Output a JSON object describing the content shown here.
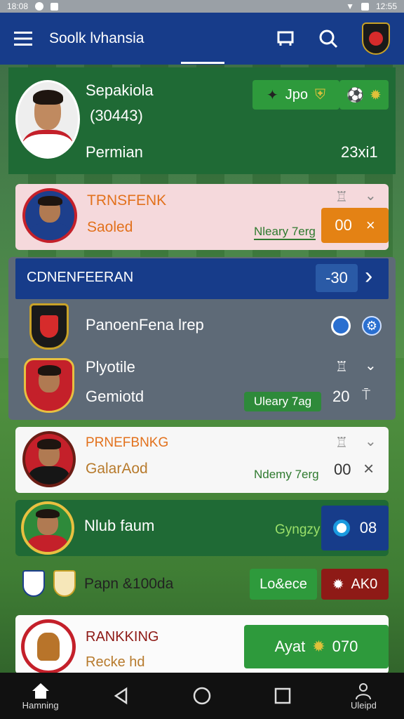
{
  "statusbar": {
    "time_left": "18:08",
    "time_right": "12:55"
  },
  "appbar": {
    "title": "Soolk lvhansia"
  },
  "profile": {
    "name": "Sepakiola",
    "id": "(30443)",
    "role": "Permian",
    "score": "23xi1",
    "badge": "Jpo"
  },
  "transfer": {
    "title": "TRNSFENK",
    "status": "Saoled",
    "tag": "Nleary 7erg",
    "value": "00",
    "close": "×"
  },
  "section": {
    "title": "CDNENFEERAN",
    "value": "-30",
    "arrow": "›"
  },
  "team_panel": {
    "team_name": "PanoenFena lrep",
    "player_name": "Plyotile",
    "player_role": "Gemiotd",
    "tag": "Uleary 7ag",
    "value": "20"
  },
  "ranking_card": {
    "title": "PRNEFBNKG",
    "status": "GalarAod",
    "tag": "Ndemy 7erg",
    "value": "00",
    "close": "×"
  },
  "club": {
    "name": "Nlub faum",
    "label": "Gyngzy",
    "value": "08"
  },
  "match": {
    "name": "Papn &100da",
    "btn_green": "Lo&ece",
    "btn_red": "AK0"
  },
  "ranking": {
    "title": "RANKKING",
    "subtitle": "Recke hd",
    "button_text": "Ayat",
    "button_value": "070"
  },
  "bottom_nav": {
    "home_label": "Hamning",
    "user_label": "Uleipd"
  },
  "colors": {
    "navy": "#173c8a",
    "green": "#1f6a35",
    "orange": "#e48214",
    "red": "#8e1a16"
  }
}
